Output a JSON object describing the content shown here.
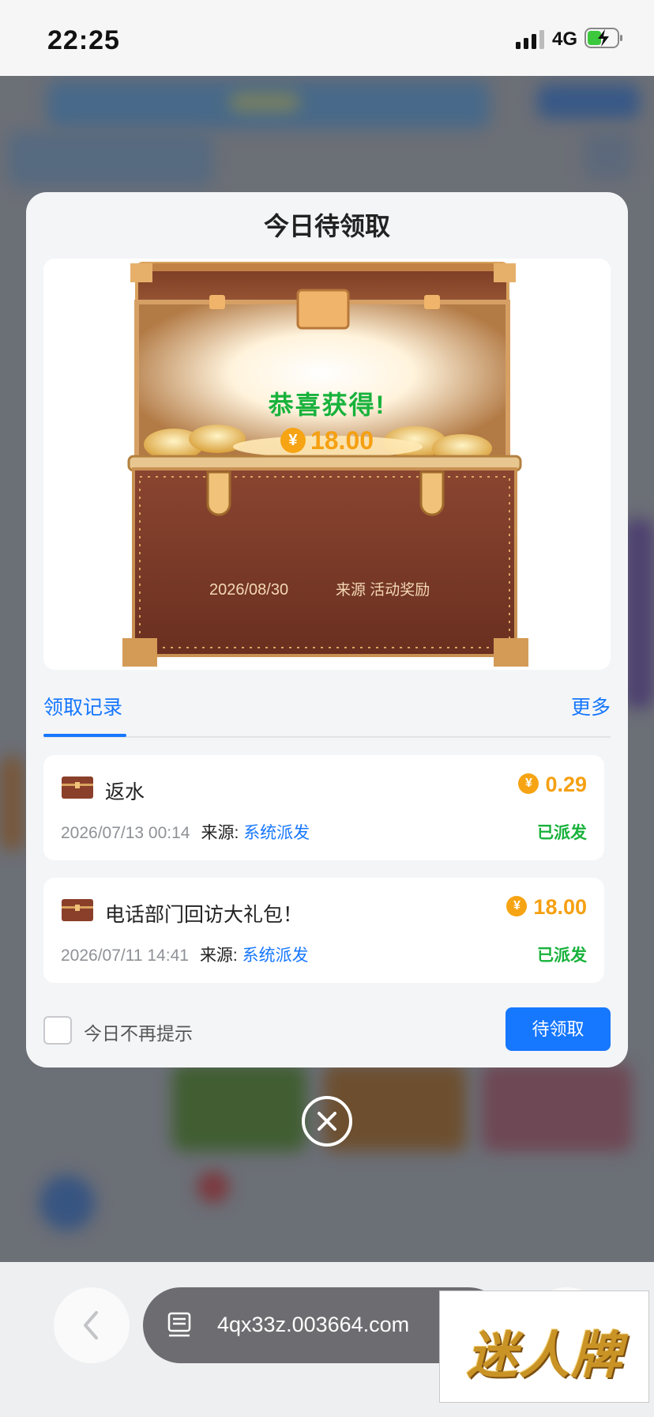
{
  "status_bar": {
    "time": "22:25",
    "network": "4G"
  },
  "modal": {
    "title": "今日待领取",
    "hero": {
      "congrats": "恭喜获得!",
      "currency_symbol": "¥",
      "amount": "18.00",
      "date": "2026/08/30",
      "source": "来源  活动奖励"
    },
    "tabs": {
      "active": "领取记录",
      "more": "更多"
    },
    "records": [
      {
        "title": "返水",
        "amount": "0.29",
        "datetime": "2026/07/13 00:14",
        "source_label": "来源:",
        "source": "系统派发",
        "status": "已派发"
      },
      {
        "title": "电话部门回访大礼包！",
        "amount": "18.00",
        "datetime": "2026/07/11 14:41",
        "source_label": "来源:",
        "source": "系统派发",
        "status": "已派发"
      }
    ],
    "footer": {
      "dont_show_label": "今日不再提示",
      "claim_button": "待领取"
    }
  },
  "browser": {
    "url": "4qx33z.003664.com"
  },
  "watermark": {
    "text": "迷人牌"
  },
  "colors": {
    "accent": "#1677ff",
    "success": "#18b23c",
    "coin": "#f5a012"
  }
}
